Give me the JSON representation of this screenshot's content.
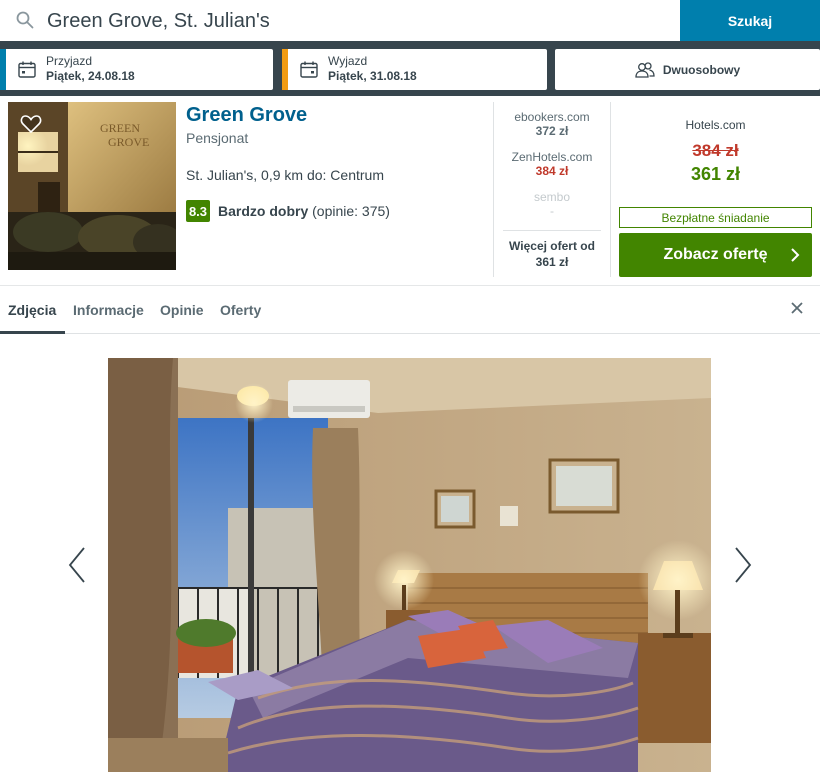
{
  "search": {
    "query": "Green Grove, St. Julian's",
    "button_label": "Szukaj"
  },
  "checkin": {
    "label": "Przyjazd",
    "value": "Piątek, 24.08.18",
    "accent_color": "#007fad"
  },
  "checkout": {
    "label": "Wyjazd",
    "value": "Piątek, 31.08.18",
    "accent_color": "#f39c12"
  },
  "room": {
    "label": "Dwuosobowy",
    "icon": "guests-icon"
  },
  "hotel": {
    "name": "Green Grove",
    "type": "Pensjonat",
    "location": "St. Julian's, 0,9 km do: Centrum",
    "rating_score": "8.3",
    "rating_label": "Bardzo dobry",
    "rating_reviews": "(opinie: 375)"
  },
  "deals": [
    {
      "site": "ebookers.com",
      "price": "372 zł"
    },
    {
      "site": "ZenHotels.com",
      "price": "384 zł"
    },
    {
      "site": "sembo",
      "price": "-"
    }
  ],
  "more_offers": {
    "line1": "Więcej ofert od",
    "line2": "361 zł"
  },
  "best_deal": {
    "site": "Hotels.com",
    "old_price": "384 zł",
    "price": "361 zł",
    "perk": "Bezpłatne śniadanie",
    "button_label": "Zobacz ofertę"
  },
  "tabs": [
    "Zdjęcia",
    "Informacje",
    "Opinie",
    "Oferty"
  ],
  "colors": {
    "brand_dark": "#37454d",
    "brand_blue": "#007fad",
    "green": "#428500",
    "red": "#c0392b"
  }
}
